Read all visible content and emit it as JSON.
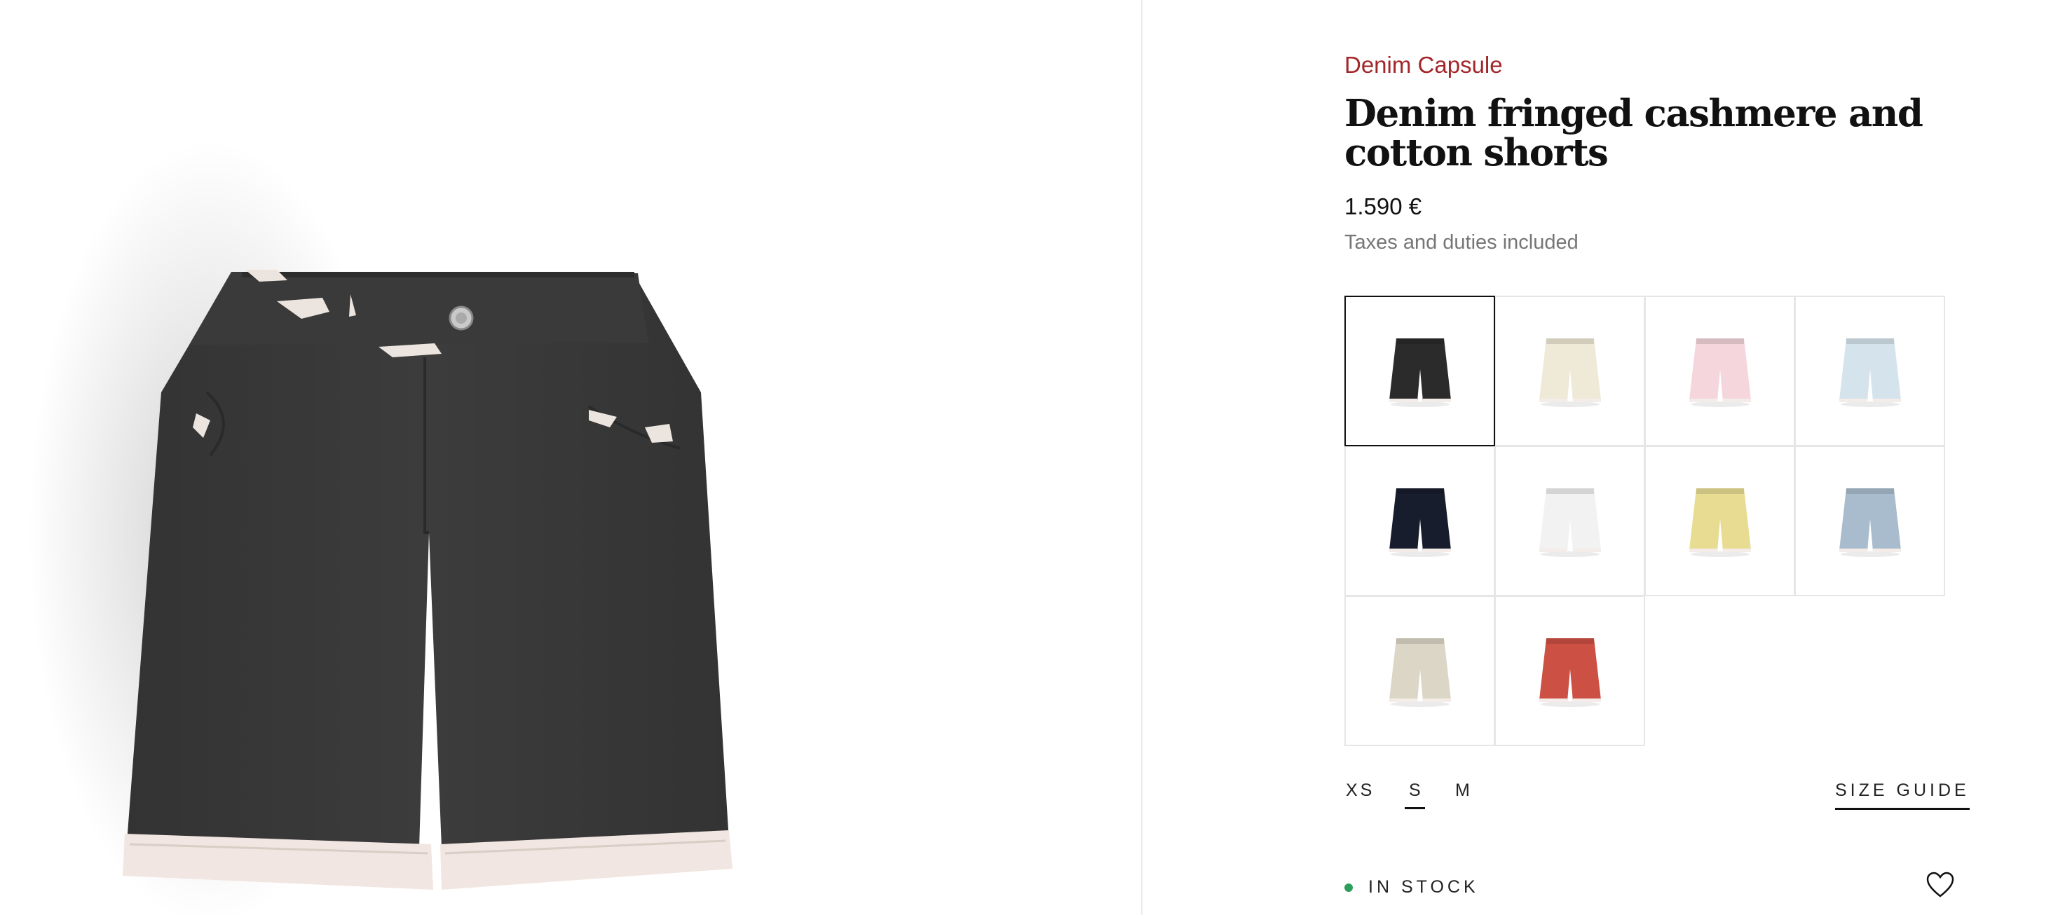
{
  "product": {
    "collection": "Denim Capsule",
    "title": "Denim fringed cashmere and cotton shorts",
    "price": "1.590 €",
    "tax_note": "Taxes and duties included",
    "hero_image": {
      "alt": "black-fringed-shorts-image",
      "color": "#3a3a3a",
      "fringe_color": "#f1e6e1"
    }
  },
  "colors": [
    {
      "name": "black",
      "hex": "#2b2b2b",
      "selected": true
    },
    {
      "name": "ivory",
      "hex": "#efe9d8",
      "selected": false
    },
    {
      "name": "pink",
      "hex": "#f4d6dc",
      "selected": false
    },
    {
      "name": "light-blue",
      "hex": "#d5e4ec",
      "selected": false
    },
    {
      "name": "navy",
      "hex": "#181d2d",
      "selected": false
    },
    {
      "name": "white",
      "hex": "#f2f2f2",
      "selected": false
    },
    {
      "name": "yellow",
      "hex": "#e8dc92",
      "selected": false
    },
    {
      "name": "denim-blue",
      "hex": "#a9bccd",
      "selected": false
    },
    {
      "name": "beige",
      "hex": "#dcd6c6",
      "selected": false
    },
    {
      "name": "red",
      "hex": "#cc5044",
      "selected": false
    }
  ],
  "sizes": [
    {
      "label": "XS",
      "active": false
    },
    {
      "label": "S",
      "active": true
    },
    {
      "label": "M",
      "active": false
    }
  ],
  "size_guide_label": "SIZE GUIDE",
  "stock": {
    "label": "IN STOCK",
    "status_color": "#2e9e5b"
  },
  "wishlist_icon": "heart-icon"
}
